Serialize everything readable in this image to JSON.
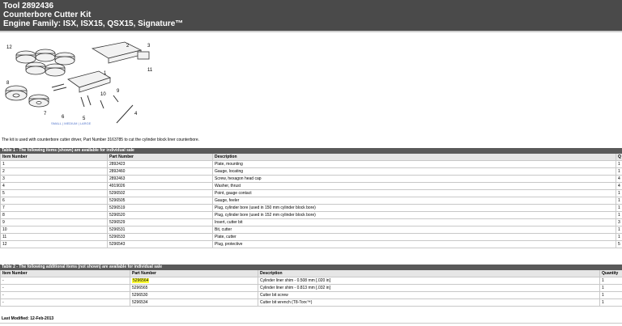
{
  "header": {
    "tool": "Tool 2892436",
    "name": "Counterbore Cutter Kit",
    "engine_family": "Engine Family: ISX, ISX15, QSX15, Signature™"
  },
  "illustration": {
    "callouts": [
      "12",
      "2",
      "3",
      "11",
      "1",
      "10",
      "9",
      "8",
      "7",
      "6",
      "5",
      "4"
    ],
    "caption": "SMALL | MEDIUM | LARGE"
  },
  "intro": "The kit is used with counterbore cutter driver, Part Number 3163785 to cut the cylinder block liner counterbore.",
  "table1": {
    "title": "Table 1 - The following items (shown) are available for individual sale",
    "headers": [
      "Item Number",
      "Part Number",
      "Description",
      "Q"
    ],
    "rows": [
      [
        "1",
        "2892423",
        "Plate, mounting",
        "1"
      ],
      [
        "2",
        "2892460",
        "Gauge, locating",
        "1"
      ],
      [
        "3",
        "2892463",
        "Screw, hexagon head cap",
        "4"
      ],
      [
        "4",
        "4919026",
        "Washer, thrust",
        "4"
      ],
      [
        "5",
        "5296502",
        "Point, gauge contact",
        "1"
      ],
      [
        "6",
        "5296505",
        "Gauge, feeler",
        "1"
      ],
      [
        "7",
        "5296519",
        "Plug, cylinder bore (used in 150 mm cylinder block bore)",
        "1"
      ],
      [
        "8",
        "5296520",
        "Plug, cylinder bore (used in 152 mm cylinder block bore)",
        "1"
      ],
      [
        "9",
        "5296529",
        "Insert, cutter bit",
        "3"
      ],
      [
        "10",
        "5296531",
        "Bit, cutter",
        "1"
      ],
      [
        "11",
        "5296533",
        "Plate, cutter",
        "1"
      ],
      [
        "12",
        "5296543",
        "Plug, protective",
        "5"
      ]
    ]
  },
  "table2": {
    "title": "Table 2 - The following additional items (not shown) are available for individual sale",
    "headers": [
      "Item Number",
      "Part Number",
      "Description",
      "Quantity"
    ],
    "rows": [
      [
        "-",
        "5296564",
        "Cylinder liner shim - 0.508 mm [.020 in]",
        "1"
      ],
      [
        "-",
        "5296565",
        "Cylinder liner shim - 0.813 mm [.032 in]",
        "1"
      ],
      [
        "-",
        "5296530",
        "Cutter bit screw",
        "1"
      ],
      [
        "-",
        "5296534",
        "Cutter bit wrench (T8-Torx™)",
        "1"
      ]
    ]
  },
  "footer": "Last Modified: 12-Feb-2013"
}
